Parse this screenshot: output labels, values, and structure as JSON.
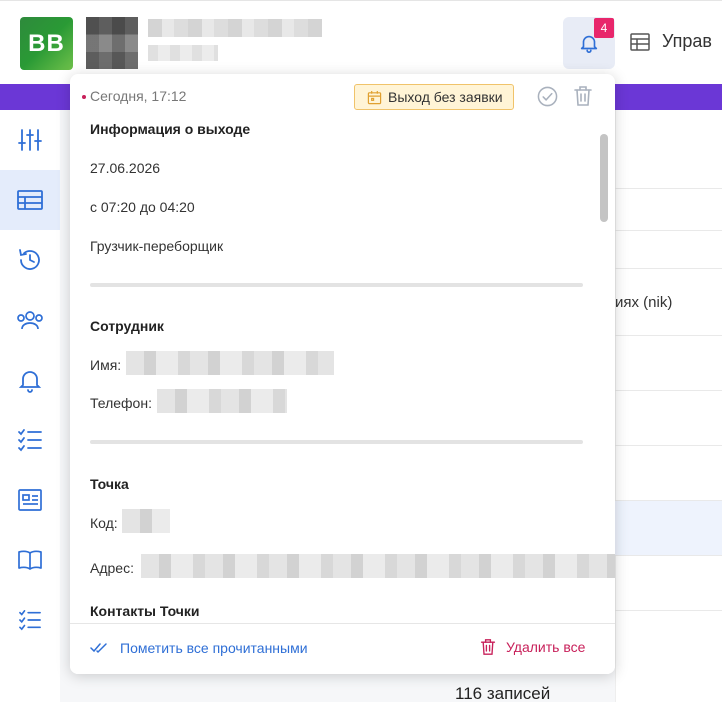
{
  "header": {
    "logo_text": "BB",
    "notifications_count": "4",
    "menu_label": "Управ"
  },
  "sidebar": {
    "items": [
      {
        "icon": "sliders-icon"
      },
      {
        "icon": "table-icon",
        "active": true
      },
      {
        "icon": "history-icon"
      },
      {
        "icon": "users-icon"
      },
      {
        "icon": "bell-icon"
      },
      {
        "icon": "checklist-icon"
      },
      {
        "icon": "id-card-icon"
      },
      {
        "icon": "book-icon"
      },
      {
        "icon": "checklist-icon"
      }
    ]
  },
  "background": {
    "cell_text": "иях (nik)",
    "records_count": "116 записей"
  },
  "notification": {
    "time": "Сегодня, 17:12",
    "tag_label": "Выход без заявки",
    "sections": {
      "exit_info": {
        "title": "Информация о выходе",
        "date": "27.06.2026",
        "time_range": "с 07:20 до 04:20",
        "role": "Грузчик-переборщик"
      },
      "employee": {
        "title": "Сотрудник",
        "name_label": "Имя:",
        "phone_label": "Телефон:"
      },
      "point": {
        "title": "Точка",
        "code_label": "Код:",
        "address_label": "Адрес:"
      },
      "contacts": {
        "title": "Контакты Точки"
      }
    },
    "footer": {
      "mark_all_label": "Пометить все прочитанными",
      "delete_all_label": "Удалить все"
    }
  },
  "colors": {
    "accent_purple": "#6b37d6",
    "badge_pink": "#e8266b",
    "link_blue": "#2f6fd6",
    "delete_red": "#c8205a",
    "tag_bg": "#fff4d6"
  }
}
